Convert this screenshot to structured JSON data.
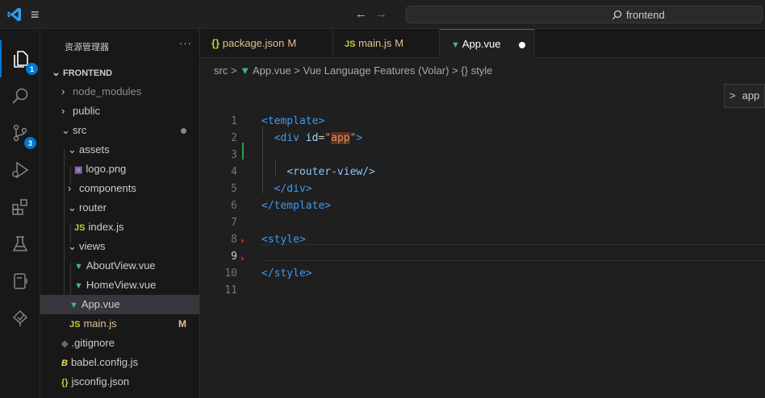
{
  "titlebar": {
    "nav_back": "←",
    "nav_forward": "→",
    "search_text": "frontend"
  },
  "activity": {
    "explorer_badge": "1",
    "scm_badge": "3"
  },
  "explorer": {
    "title": "资源管理器",
    "more": "···",
    "root": "FRONTEND",
    "items": [
      {
        "label": "node_modules"
      },
      {
        "label": "public"
      },
      {
        "label": "src"
      },
      {
        "label": "assets"
      },
      {
        "label": "logo.png"
      },
      {
        "label": "components"
      },
      {
        "label": "router"
      },
      {
        "label": "index.js"
      },
      {
        "label": "views"
      },
      {
        "label": "AboutView.vue"
      },
      {
        "label": "HomeView.vue"
      },
      {
        "label": "App.vue"
      },
      {
        "label": "main.js",
        "status": "M"
      },
      {
        "label": ".gitignore"
      },
      {
        "label": "babel.config.js"
      },
      {
        "label": "jsconfig.json"
      }
    ]
  },
  "tabs": [
    {
      "icon": "{}",
      "label": "package.json",
      "status": "M"
    },
    {
      "icon": "JS",
      "label": "main.js",
      "status": "M"
    },
    {
      "icon": "▼",
      "label": "App.vue"
    }
  ],
  "breadcrumb": {
    "part1": "src",
    "part2": "App.vue",
    "part3": "Vue Language Features (Volar)",
    "part4": "style",
    "sep": ">",
    "braces": "{}"
  },
  "code": {
    "line_numbers": [
      "1",
      "2",
      "3",
      "4",
      "5",
      "6",
      "7",
      "8",
      "9",
      "10",
      "11"
    ],
    "l1": "<template>",
    "l2_open": "<div",
    "l2_attr": "id",
    "l2_eq": "=",
    "l2_q1": "\"",
    "l2_val": "app",
    "l2_q2": "\"",
    "l2_close": ">",
    "l4": "<router-view/>",
    "l5": "</div>",
    "l6": "</template>",
    "l8": "<style>",
    "l10": "</style>"
  },
  "sticky": {
    "chevron": ">",
    "label": "app"
  },
  "colors": {
    "accent": "#0078d4",
    "vue_green": "#41b883",
    "js_yellow": "#cbcb41",
    "modified": "#e2c08d",
    "error_red": "#e51400"
  }
}
